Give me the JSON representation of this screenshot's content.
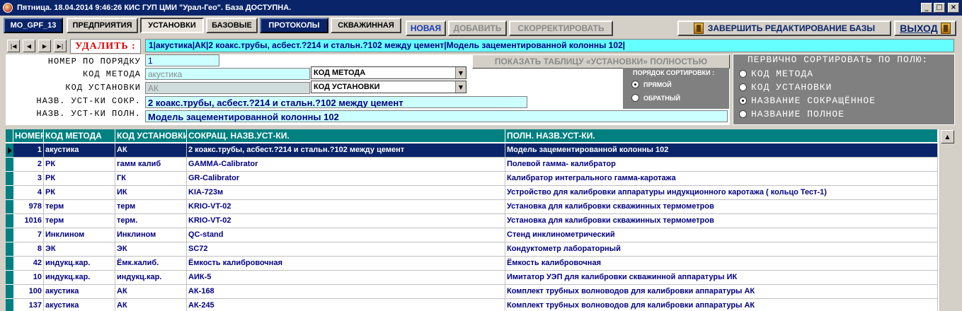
{
  "window": {
    "title": "Пятница. 18.04.2014 9:46:26  КИС ГУП ЦМИ \"Урал-Гео\". База ДОСТУПНА."
  },
  "toolbar": {
    "db_button": "MO_GPF_13",
    "tabs": [
      "ПРЕДПРИЯТИЯ",
      "УСТАНОВКИ",
      "БАЗОВЫЕ",
      "ПРОТОКОЛЫ",
      "СКВАЖИННАЯ"
    ],
    "new": "НОВАЯ",
    "add": "ДОБАВИТЬ",
    "correct": "СКОРРЕКТИРОВАТЬ",
    "finish_edit": "ЗАВЕРШИТЬ РЕДАКТИРОВАНИЕ БАЗЫ",
    "exit": "ВЫХОД"
  },
  "navigator": {
    "delete_label": "УДАЛИТЬ :",
    "record_summary": "1|акустика|АК|2 коакс.трубы, асбест.?214 и стальн.?102 между цемент|Модель зацементированной колонны 102|"
  },
  "form": {
    "labels": {
      "number": "НОМЕР ПО ПОРЯДКУ",
      "method_code": "КОД МЕТОДА",
      "install_code": "КОД УСТАНОВКИ",
      "short_name": "НАЗВ. УСТ-КИ СОКР.",
      "full_name": "НАЗВ. УСТ-КИ ПОЛН."
    },
    "values": {
      "number": "1",
      "method_code": "акустика",
      "install_code": "АК",
      "short_name": "2 коакс.трубы, асбест.?214 и стальн.?102 между цемент",
      "full_name": "Модель зацементированной колонны 102"
    },
    "selects": {
      "method_code": "КОД МЕТОДА",
      "install_code": "КОД УСТАНОВКИ"
    },
    "show_all": "ПОКАЗАТЬ ТАБЛИЦУ «УСТАНОВКИ» ПОЛНОСТЬЮ"
  },
  "sort_order": {
    "legend": "ПОРЯДОК СОРТИРОВКИ :",
    "options": [
      "ПРЯМОЙ",
      "ОБРАТНЫЙ"
    ],
    "selected": "ПРЯМОЙ"
  },
  "primary_sort": {
    "legend": "ПЕРВИЧНО СОРТИРОВАТЬ ПО ПОЛЮ:",
    "options": [
      "КОД МЕТОДА",
      "КОД УСТАНОВКИ",
      "НАЗВАНИЕ СОКРАЩЁННОЕ",
      "НАЗВАНИЕ ПОЛНОЕ"
    ],
    "selected": "НАЗВАНИЕ СОКРАЩЁННОЕ"
  },
  "grid": {
    "columns": [
      "НОМЕР",
      "КОД МЕТОДА",
      "КОД УСТАНОВКИ",
      "СОКРАЩ. НАЗВ.УСТ-КИ.",
      "ПОЛН. НАЗВ.УСТ-КИ."
    ],
    "rows": [
      [
        "1",
        "акустика",
        "АК",
        "2 коакс.трубы, асбест.?214 и стальн.?102 между цемент",
        "Модель зацементированной колонны 102"
      ],
      [
        "2",
        "РК",
        "гамм калиб",
        "GAMMA-Calibrator",
        "Полевой гамма- калибратор"
      ],
      [
        "3",
        "РК",
        "ГК",
        "GR-Calibrator",
        "Калибратор интегрального гамма-каротажа"
      ],
      [
        "4",
        "РК",
        "ИК",
        "KIA-723м",
        "Устройство для калибровки аппаратуры индукционного каротажа ( кольцо Тест-1)"
      ],
      [
        "978",
        "терм",
        "терм",
        "KRIO-VT-02",
        "Установка для калибровки скважинных термометров"
      ],
      [
        "1016",
        "терм",
        "терм.",
        "KRIO-VT-02",
        "Установка для калибровки скважинных термометров"
      ],
      [
        "7",
        "Инклином",
        "Инклином",
        "QC-stand",
        "Стенд инклинометрический"
      ],
      [
        "8",
        "ЭК",
        "ЭК",
        "SC72",
        "Кондуктометр лабораторный"
      ],
      [
        "42",
        "индукц.кар.",
        "Ёмк.калиб.",
        "Ёмкость калибровочная",
        "Ёмкость калибровочная"
      ],
      [
        "10",
        "индукц.кар.",
        "индукц.кар.",
        "АИК-5",
        "Имитатор УЭП для калибровки скважинной аппаратуры ИК"
      ],
      [
        "100",
        "акустика",
        "АК",
        "АК-168",
        "Комплект трубных волноводов для калибровки аппаратуры АК"
      ],
      [
        "137",
        "акустика",
        "АК",
        "АК-245",
        "Комплект трубных волноводов для калибровки аппаратуры АК"
      ]
    ],
    "selected_row": 0
  },
  "colors": {
    "title_bar": "#0a246a",
    "header_teal": "#008080",
    "field_cyan": "#66ffff",
    "delete_red": "#e00000"
  }
}
